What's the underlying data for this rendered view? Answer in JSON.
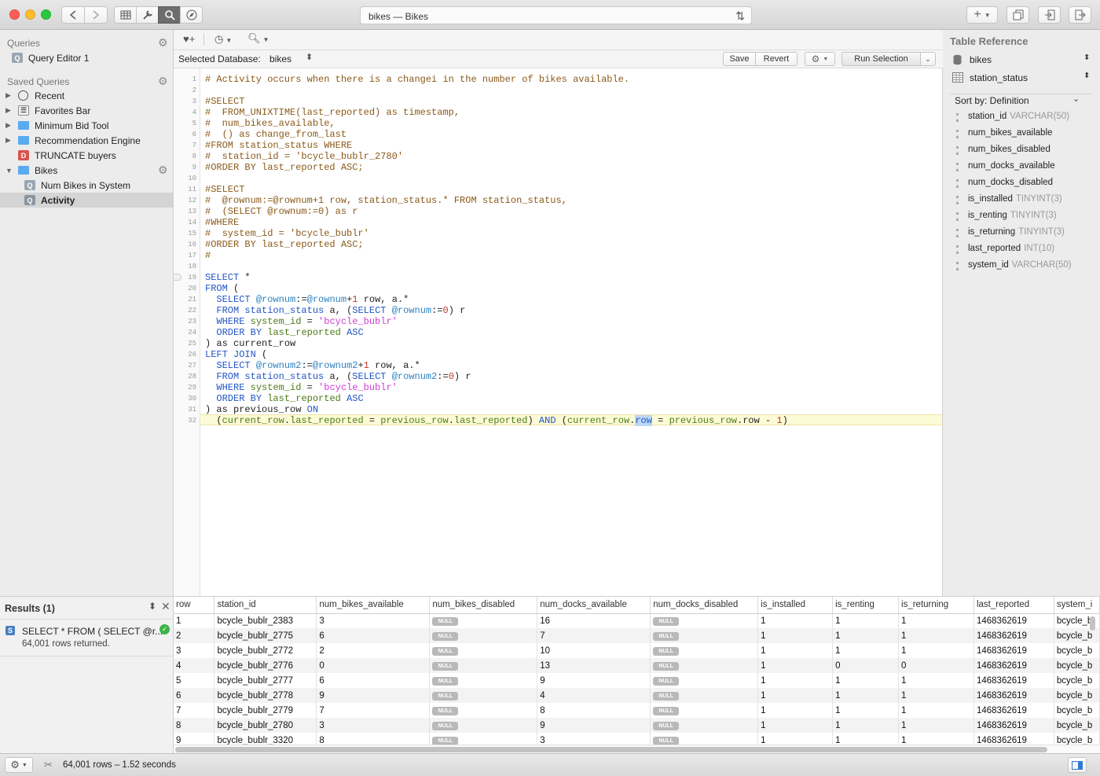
{
  "window": {
    "title": "bikes — Bikes",
    "traffic_colors": [
      "#ff5f57",
      "#febc2e",
      "#28c840"
    ]
  },
  "sidebar": {
    "queries_header": "Queries",
    "queries": [
      {
        "label": "Query Editor 1",
        "icon": "query-icon"
      }
    ],
    "saved_header": "Saved Queries",
    "saved": [
      {
        "label": "Recent",
        "icon": "clock-icon"
      },
      {
        "label": "Favorites Bar",
        "icon": "favorites-icon"
      },
      {
        "label": "Minimum Bid Tool",
        "icon": "folder-icon"
      },
      {
        "label": "Recommendation Engine",
        "icon": "folder-icon"
      },
      {
        "label": "TRUNCATE buyers",
        "icon": "destructive-query-icon",
        "badge": "D"
      },
      {
        "label": "Bikes",
        "icon": "folder-icon"
      },
      {
        "label": "Num Bikes in System",
        "icon": "query-icon"
      },
      {
        "label": "Activity",
        "icon": "query-icon",
        "selected": true
      }
    ]
  },
  "db_bar": {
    "label": "Selected Database:",
    "database": "bikes",
    "save": "Save",
    "revert": "Revert",
    "run": "Run Selection"
  },
  "editor": {
    "line_count": 32,
    "current_line": 32,
    "lines": [
      "# Activity occurs when there is a changei in the number of bikes available.",
      "",
      "#SELECT",
      "#  FROM_UNIXTIME(last_reported) as timestamp,",
      "#  num_bikes_available,",
      "#  () as change_from_last",
      "#FROM station_status WHERE",
      "#  station_id = 'bcycle_bublr_2780'",
      "#ORDER BY last_reported ASC;",
      "",
      "#SELECT",
      "#  @rownum:=@rownum+1 row, station_status.* FROM station_status,",
      "#  (SELECT @rownum:=0) as r",
      "#WHERE",
      "#  system_id = 'bcycle_bublr'",
      "#ORDER BY last_reported ASC;",
      "#",
      "",
      "SELECT *",
      "FROM (",
      "  SELECT @rownum:=@rownum+1 row, a.*",
      "  FROM station_status a, (SELECT @rownum:=0) r",
      "  WHERE system_id = 'bcycle_bublr'",
      "  ORDER BY last_reported ASC",
      ") as current_row",
      "LEFT JOIN (",
      "  SELECT @rownum2:=@rownum2+1 row, a.*",
      "  FROM station_status a, (SELECT @rownum2:=0) r",
      "  WHERE system_id = 'bcycle_bublr'",
      "  ORDER BY last_reported ASC",
      ") as previous_row ON",
      "  (current_row.last_reported = previous_row.last_reported) AND (current_row.row = previous_row.row - 1)"
    ]
  },
  "table_reference": {
    "title": "Table Reference",
    "database": "bikes",
    "table": "station_status",
    "sort": "Sort by: Definition",
    "columns": [
      {
        "name": "station_id",
        "type": "VARCHAR(50)"
      },
      {
        "name": "num_bikes_available",
        "type": ""
      },
      {
        "name": "num_bikes_disabled",
        "type": ""
      },
      {
        "name": "num_docks_available",
        "type": ""
      },
      {
        "name": "num_docks_disabled",
        "type": ""
      },
      {
        "name": "is_installed",
        "type": "TINYINT(3)"
      },
      {
        "name": "is_renting",
        "type": "TINYINT(3)"
      },
      {
        "name": "is_returning",
        "type": "TINYINT(3)"
      },
      {
        "name": "last_reported",
        "type": "INT(10)"
      },
      {
        "name": "system_id",
        "type": "VARCHAR(50)"
      }
    ]
  },
  "results": {
    "header": "Results (1)",
    "query_preview": "SELECT * FROM ( SELECT @r...",
    "rows_returned": "64,001 rows returned.",
    "columns": [
      "row",
      "station_id",
      "num_bikes_available",
      "num_bikes_disabled",
      "num_docks_available",
      "num_docks_disabled",
      "is_installed",
      "is_renting",
      "is_returning",
      "last_reported",
      "system_i"
    ],
    "rows": [
      [
        "1",
        "bcycle_bublr_2383",
        "3",
        "NULL",
        "16",
        "NULL",
        "1",
        "1",
        "1",
        "1468362619",
        "bcycle_b"
      ],
      [
        "2",
        "bcycle_bublr_2775",
        "6",
        "NULL",
        "7",
        "NULL",
        "1",
        "1",
        "1",
        "1468362619",
        "bcycle_b"
      ],
      [
        "3",
        "bcycle_bublr_2772",
        "2",
        "NULL",
        "10",
        "NULL",
        "1",
        "1",
        "1",
        "1468362619",
        "bcycle_b"
      ],
      [
        "4",
        "bcycle_bublr_2776",
        "0",
        "NULL",
        "13",
        "NULL",
        "1",
        "0",
        "0",
        "1468362619",
        "bcycle_b"
      ],
      [
        "5",
        "bcycle_bublr_2777",
        "6",
        "NULL",
        "9",
        "NULL",
        "1",
        "1",
        "1",
        "1468362619",
        "bcycle_b"
      ],
      [
        "6",
        "bcycle_bublr_2778",
        "9",
        "NULL",
        "4",
        "NULL",
        "1",
        "1",
        "1",
        "1468362619",
        "bcycle_b"
      ],
      [
        "7",
        "bcycle_bublr_2779",
        "7",
        "NULL",
        "8",
        "NULL",
        "1",
        "1",
        "1",
        "1468362619",
        "bcycle_b"
      ],
      [
        "8",
        "bcycle_bublr_2780",
        "3",
        "NULL",
        "9",
        "NULL",
        "1",
        "1",
        "1",
        "1468362619",
        "bcycle_b"
      ],
      [
        "9",
        "bcycle_bublr_3320",
        "8",
        "NULL",
        "3",
        "NULL",
        "1",
        "1",
        "1",
        "1468362619",
        "bcycle_b"
      ]
    ]
  },
  "status": {
    "summary": "64,001 rows – 1.52 seconds"
  }
}
